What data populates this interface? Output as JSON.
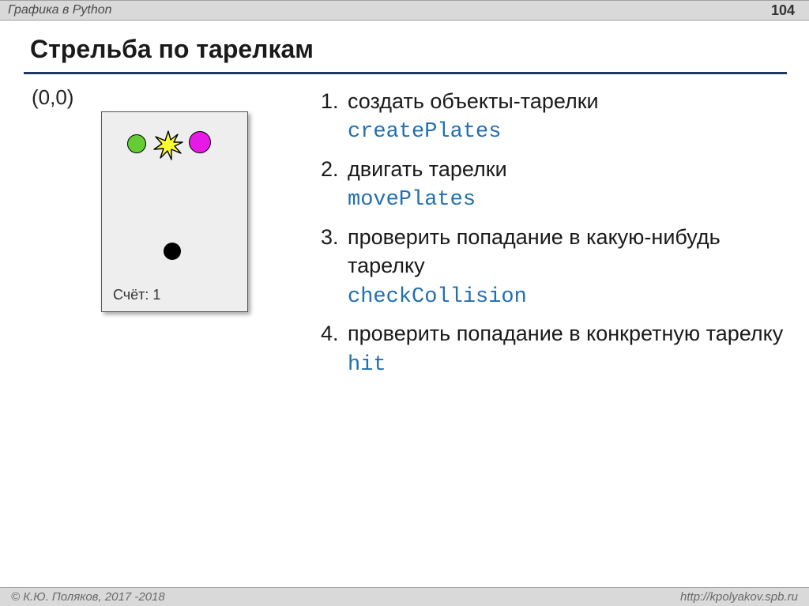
{
  "header": {
    "topic": "Графика в Python",
    "page_number": "104"
  },
  "slide": {
    "title": "Стрельба по тарелкам"
  },
  "diagram": {
    "origin_label": "(0,0)",
    "score_text": "Счёт: 1"
  },
  "steps": [
    {
      "text": "создать объекты-тарелки",
      "code": "createPlates"
    },
    {
      "text": "двигать тарелки",
      "code": "movePlates"
    },
    {
      "text": "проверить попадание в какую-нибудь тарелку",
      "code": "checkCollision"
    },
    {
      "text": "проверить попадание в конкретную тарелку",
      "code": "hit"
    }
  ],
  "footer": {
    "copyright": "© К.Ю. Поляков, 2017 -2018",
    "url": "http://kpolyakov.spb.ru"
  }
}
